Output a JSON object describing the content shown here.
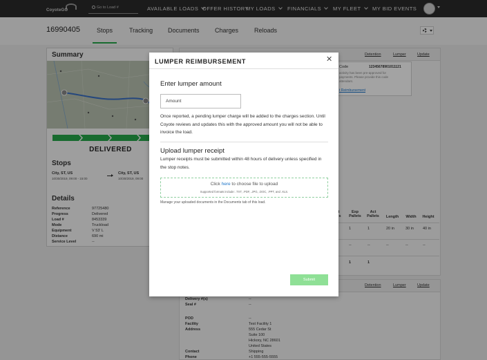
{
  "nav": {
    "logo_text": "CoyoteGO",
    "search_placeholder": "Go to Load #",
    "items": [
      {
        "label": "AVAILABLE LOADS",
        "has_chevron": true
      },
      {
        "label": "OFFER HISTORY",
        "has_chevron": false
      },
      {
        "label": "MY LOADS",
        "has_chevron": true
      },
      {
        "label": "FINANCIALS",
        "has_chevron": true
      },
      {
        "label": "MY FLEET",
        "has_chevron": true
      },
      {
        "label": "MY BID EVENTS",
        "has_chevron": false
      }
    ]
  },
  "subheader": {
    "load_number": "16990405",
    "tabs": [
      "Stops",
      "Tracking",
      "Documents",
      "Charges",
      "Reloads"
    ],
    "active_tab": "Stops"
  },
  "summary": {
    "title": "Summary",
    "status": "DELIVERED",
    "stops_title": "Stops",
    "origin": {
      "city": "City, ST, US",
      "date": "10/30/2019, 09:00 - 15:00"
    },
    "destination": {
      "city": "City, ST, US",
      "date": "10/30/2019, 09:00"
    },
    "details_title": "Details",
    "details": [
      {
        "key": "Reference",
        "value": "97725480"
      },
      {
        "key": "Progress",
        "value": "Delivered"
      },
      {
        "key": "Load #",
        "value": "8453339"
      },
      {
        "key": "Mode",
        "value": "Truckload"
      },
      {
        "key": "Equipment",
        "value": "V 53' L"
      },
      {
        "key": "Distance",
        "value": "690 mi"
      },
      {
        "key": "Service Level",
        "value": "--"
      }
    ]
  },
  "stop_panel": {
    "links": [
      "Detention",
      "Lumper",
      "Update"
    ],
    "code_label": "Code",
    "code_value": "12345678901011121",
    "info_text": [
      "activity has been pre-approved for",
      "payments. Please provide this code",
      "attendant."
    ],
    "reimb_link": "t Reimbursement",
    "table_headers": [
      "ct\nces",
      "Exp\nPallets",
      "Act\nPallets",
      "Length",
      "Width",
      "Height"
    ],
    "row1": [
      "1",
      "1",
      "1",
      "20 in",
      "30 in",
      "40 in"
    ],
    "row2": [
      "--",
      "--",
      "--",
      "--",
      "--",
      "--"
    ],
    "totals": [
      "1",
      "1"
    ]
  },
  "stop_panel2": {
    "links": [
      "Detention",
      "Lumper",
      "Update"
    ],
    "fields": [
      {
        "key": "Delivery #(s)",
        "value": "--"
      },
      {
        "key": "Seal #",
        "value": "--"
      },
      {
        "key": "POD",
        "value": "--"
      },
      {
        "key": "Facility",
        "value": "Test Facility 1"
      },
      {
        "key": "Address",
        "value": "555 Cedar St"
      },
      {
        "key": "",
        "value": "Suite 100"
      },
      {
        "key": "",
        "value": "Hickory, NC 28601"
      },
      {
        "key": "",
        "value": "United States"
      },
      {
        "key": "Contact",
        "value": "Shipping"
      },
      {
        "key": "Phone",
        "value": "+1 555-555-5555"
      }
    ]
  },
  "modal": {
    "title": "LUMPER REIMBURSEMENT",
    "amount_heading": "Enter lumper amount",
    "amount_placeholder": "Amount",
    "amount_text": "Once reported, a pending lumper charge will be added to the charges section. Until Coyote reviews and updates this with the approved amount you will not be able to invoice the load.",
    "upload_heading": "Upload lumper receipt",
    "upload_text": "Lumper receipts must be submitted within 48 hours of delivery unless specified in the stop notes.",
    "drop_pre": "Click ",
    "drop_link": "here",
    "drop_post": " to choose file to upload",
    "drop_formats": "Supported formats include: .TXT, .PDF, .JPG, .DOC, .PPT, and .XLS.",
    "manage_note": "Manage your uploaded documents in the Documents tab of this load.",
    "submit_label": "Submit"
  },
  "colors": {
    "accent_green": "#27a84a",
    "submit_disabled": "#8fe096",
    "nav_bg": "#2b2b2b",
    "link_blue": "#1c74c8"
  }
}
